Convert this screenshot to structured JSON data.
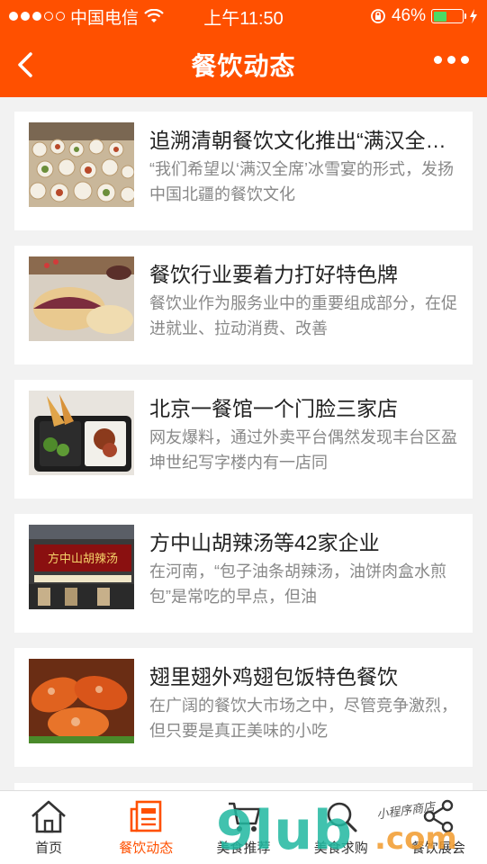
{
  "status_bar": {
    "carrier": "中国电信",
    "time": "上午11:50",
    "battery_percent": "46%",
    "battery_level": 0.46
  },
  "navbar": {
    "title": "餐饮动态",
    "back_icon": "chevron-left-icon",
    "more_icon": "more-dots-icon"
  },
  "articles": [
    {
      "title": "追溯清朝餐饮文化推出“满汉全席”冰雪宴",
      "desc": "“我们希望以‘满汉全席’冰雪宴的形式，发扬中国北疆的餐饮文化"
    },
    {
      "title": "餐饮行业要着力打好特色牌",
      "desc": "餐饮业作为服务业中的重要组成部分，在促进就业、拉动消费、改善"
    },
    {
      "title": "北京一餐馆一个门脸三家店",
      "desc": "网友爆料，通过外卖平台偶然发现丰台区盈坤世纪写字楼内有一店同"
    },
    {
      "title": "方中山胡辣汤等42家企业",
      "desc": "在河南，“包子油条胡辣汤，油饼肉盒水煎包”是常吃的早点，但油"
    },
    {
      "title": "翅里翅外鸡翅包饭特色餐饮",
      "desc": "在广阔的餐饮大市场之中，尽管竞争激烈，但只要是真正美味的小吃"
    }
  ],
  "tabs": [
    {
      "label": "首页",
      "icon": "home-icon"
    },
    {
      "label": "餐饮动态",
      "icon": "news-icon",
      "active": true
    },
    {
      "label": "美食推荐",
      "icon": "cart-icon"
    },
    {
      "label": "美食求购",
      "icon": "search-icon"
    },
    {
      "label": "餐饮展会",
      "icon": "share-icon"
    }
  ],
  "watermark": {
    "main": "9lub",
    "suffix": ".com",
    "small": "小程序商店"
  },
  "colors": {
    "brand": "#ff5000",
    "battery": "#4cd964",
    "tab_active": "#ff5000"
  }
}
